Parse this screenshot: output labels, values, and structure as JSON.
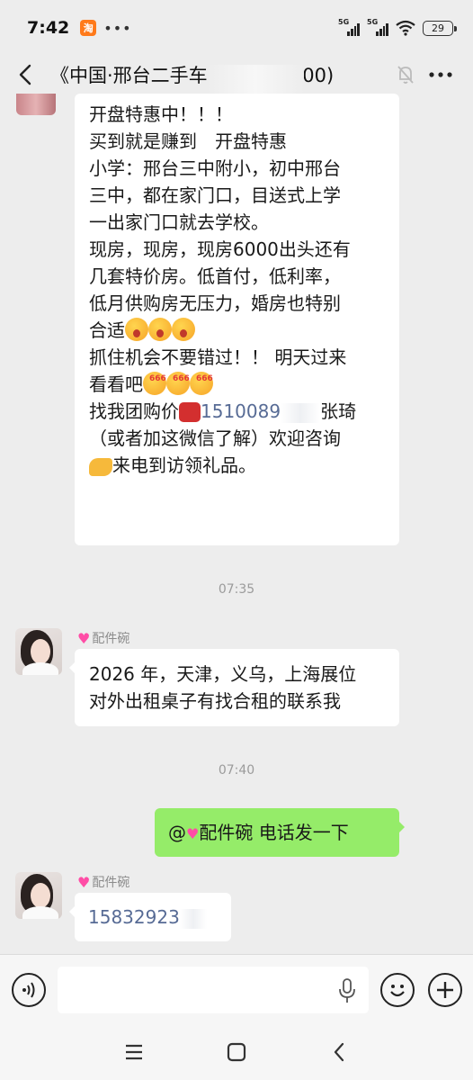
{
  "status_bar": {
    "time": "7:42",
    "app_badge": "淘",
    "more_dots": "•••",
    "signal_1_label": "5G",
    "signal_2_label": "5G",
    "battery": "29"
  },
  "header": {
    "title": "《中国·邢台二手车配件群》(500)"
  },
  "messages": {
    "msg1": {
      "lines": {
        "l1": "开盘特惠中！！！",
        "l2": "买到就是赚到　开盘特惠",
        "l3": "小学：邢台三中附小，初中邢台",
        "l4": "三中，都在家门口，目送式上学",
        "l5": "一出家门口就去学校。",
        "l6": "现房，现房，现房6000出头还有",
        "l7": "几套特价房。低首付，低利率，",
        "l8": "低月供购房无压力，婚房也特别",
        "l9": "合适",
        "l10": "抓住机会不要错过！！ 明天过来",
        "l11": "看看吧",
        "l12_prefix": "找我团购价",
        "l12_phone": "1510089",
        "l12_suffix": "张琦",
        "l13": "（或者加这微信了解）欢迎咨询",
        "l14": "来电到访领礼品。"
      }
    },
    "time1": "07:35",
    "msg2": {
      "sender": "配件碗",
      "line1": "2026 年，天津，义乌，上海展位",
      "line2": "对外出租桌子有找合租的联系我"
    },
    "time2": "07:40",
    "msg3": {
      "text_prefix": "@",
      "text_name": "配件碗",
      "text_body": "  电话发一下"
    },
    "msg4": {
      "sender": "配件碗",
      "text": "15832923"
    }
  },
  "colors": {
    "background": "#ededed",
    "bubble_in": "#ffffff",
    "bubble_out": "#95ec69",
    "link": "#576b95"
  }
}
